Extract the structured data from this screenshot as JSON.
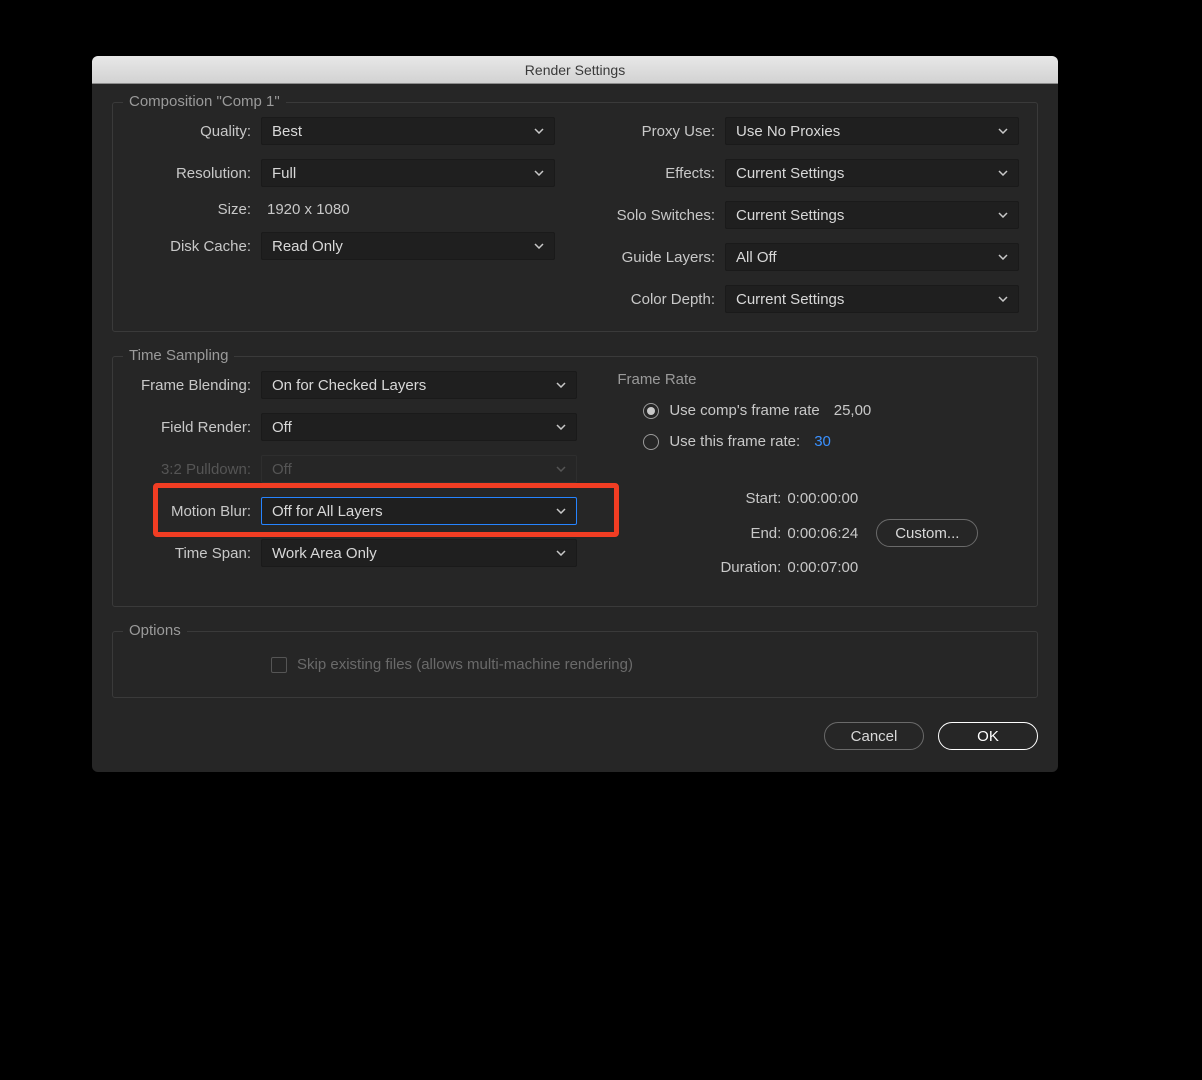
{
  "dialog": {
    "title": "Render Settings"
  },
  "composition": {
    "group_title": "Composition \"Comp 1\"",
    "quality_label": "Quality:",
    "quality_value": "Best",
    "resolution_label": "Resolution:",
    "resolution_value": "Full",
    "size_label": "Size:",
    "size_value": "1920 x 1080",
    "disk_cache_label": "Disk Cache:",
    "disk_cache_value": "Read Only",
    "proxy_label": "Proxy Use:",
    "proxy_value": "Use No Proxies",
    "effects_label": "Effects:",
    "effects_value": "Current Settings",
    "solo_label": "Solo Switches:",
    "solo_value": "Current Settings",
    "guide_label": "Guide Layers:",
    "guide_value": "All Off",
    "depth_label": "Color Depth:",
    "depth_value": "Current Settings"
  },
  "time_sampling": {
    "group_title": "Time Sampling",
    "frame_blending_label": "Frame Blending:",
    "frame_blending_value": "On for Checked Layers",
    "field_render_label": "Field Render:",
    "field_render_value": "Off",
    "pulldown_label": "3:2 Pulldown:",
    "pulldown_value": "Off",
    "motion_blur_label": "Motion Blur:",
    "motion_blur_value": "Off for All Layers",
    "time_span_label": "Time Span:",
    "time_span_value": "Work Area Only",
    "frame_rate_title": "Frame Rate",
    "use_comp_label": "Use comp's frame rate",
    "use_comp_value": "25,00",
    "use_this_label": "Use this frame rate:",
    "use_this_value": "30",
    "start_label": "Start:",
    "start_value": "0:00:00:00",
    "end_label": "End:",
    "end_value": "0:00:06:24",
    "duration_label": "Duration:",
    "duration_value": "0:00:07:00",
    "custom_label": "Custom..."
  },
  "options": {
    "group_title": "Options",
    "skip_label": "Skip existing files (allows multi-machine rendering)"
  },
  "footer": {
    "cancel": "Cancel",
    "ok": "OK"
  }
}
